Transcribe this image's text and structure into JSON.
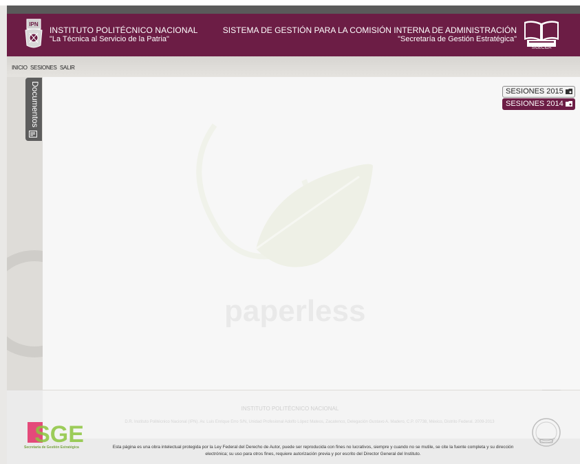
{
  "header": {
    "institution": "INSTITUTO POLITÉCNICO NACIONAL",
    "motto": "\"La Técnica al Servicio de la Patria\"",
    "system_title": "SISTEMA DE GESTIÓN PARA LA COMISIÓN INTERNA DE ADMINISTRACIÓN",
    "system_subtitle": "\"Secretaría de Gestión Estratégica\"",
    "sigecida_label": "SIGECIDA"
  },
  "nav": {
    "items": [
      "INICIO",
      "SESIONES",
      "SALIR"
    ]
  },
  "sidebar": {
    "documents_tab": "Documentos"
  },
  "sessions": {
    "buttons": [
      "SESIONES 2015",
      "SESIONES 2014"
    ]
  },
  "watermark": {
    "text": "paperless"
  },
  "footer": {
    "institution": "INSTITUTO POLITÉCNICO NACIONAL",
    "address": "D.R. Instituto Politécnico Nacional (IPN). Av. Luis Enrique Erro S/N, Unidad Profesional Adolfo López Mateos, Zacatenco, Delegación Gustavo A. Madero, C.P. 07738, México, Distrito Federal. 2009-2013",
    "legal": "Esta página es una obra intelectual protegida por la Ley Federal del Derecho de Autor, puede ser reproducida con fines no lucrativos, siempre y cuando no se mutile, se cite la fuente completa y su dirección electrónica; su uso para otros fines, requiere autorización previa y por escrito del Director General del Instituto.",
    "sge_logo": "SGE",
    "sge_caption": "Secretaría de Gestión Estratégica"
  },
  "colors": {
    "brand": "#6c1d45",
    "dark_tab": "#5d5d5d",
    "sge_pink": "#e44a7a",
    "sge_green": "#8dc63f"
  }
}
